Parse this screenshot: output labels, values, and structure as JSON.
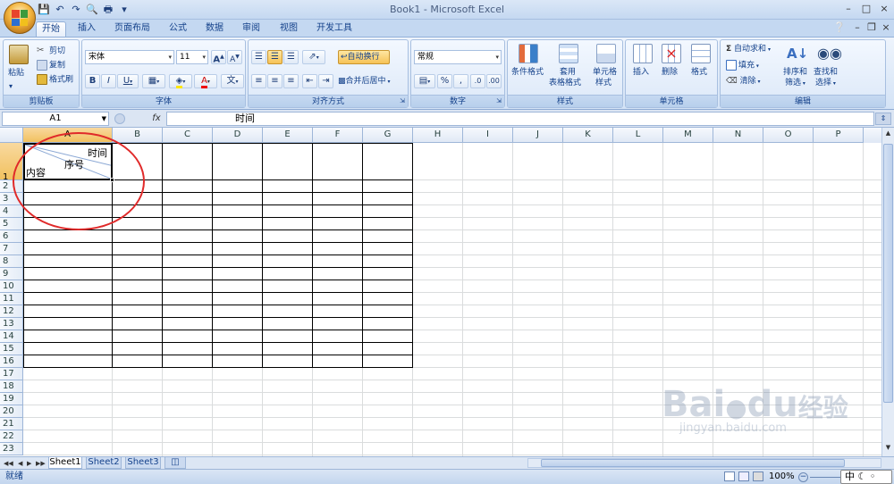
{
  "window": {
    "title": "Book1 - Microsoft Excel",
    "controls": [
      "–",
      "□",
      "×"
    ]
  },
  "tabs": [
    "开始",
    "插入",
    "页面布局",
    "公式",
    "数据",
    "审阅",
    "视图",
    "开发工具"
  ],
  "active_tab": "开始",
  "ribbon": {
    "clipboard": {
      "label": "剪贴板",
      "paste": "粘贴",
      "cut": "剪切",
      "copy": "复制",
      "format_painter": "格式刷"
    },
    "font": {
      "label": "字体",
      "font_name": "宋体",
      "font_size": "11"
    },
    "alignment": {
      "label": "对齐方式",
      "wrap_text": "自动换行",
      "merge_center": "合并后居中"
    },
    "number": {
      "label": "数字",
      "format": "常规"
    },
    "styles": {
      "label": "样式",
      "conditional_format": "条件格式",
      "table_format_l1": "套用",
      "table_format_l2": "表格格式",
      "cell_styles_l1": "单元格",
      "cell_styles_l2": "样式"
    },
    "cells": {
      "label": "单元格",
      "insert": "插入",
      "delete": "删除",
      "format": "格式"
    },
    "editing": {
      "label": "编辑",
      "autosum": "自动求和",
      "fill": "填充",
      "clear": "清除",
      "sort_filter_l1": "排序和",
      "sort_filter_l2": "筛选",
      "find_select_l1": "查找和",
      "find_select_l2": "选择"
    }
  },
  "formula_bar": {
    "name_box": "A1",
    "fx": "fx",
    "value": "时间"
  },
  "columns": [
    "A",
    "B",
    "C",
    "D",
    "E",
    "F",
    "G",
    "H",
    "I",
    "J",
    "K",
    "L",
    "M",
    "N",
    "O",
    "P"
  ],
  "rows": [
    "1",
    "2",
    "3",
    "4",
    "5",
    "6",
    "7",
    "8",
    "9",
    "10",
    "11",
    "12",
    "13",
    "14",
    "15",
    "16",
    "17",
    "18",
    "19",
    "20",
    "21",
    "22",
    "23"
  ],
  "cell_a1": {
    "top_right": "时间",
    "middle": "序号",
    "bottom_left": "内容"
  },
  "sheets": [
    "Sheet1",
    "Sheet2",
    "Sheet3"
  ],
  "active_sheet": "Sheet1",
  "status": {
    "ready": "就绪",
    "zoom": "100%",
    "ime": "中"
  },
  "watermark": {
    "text": "Bai",
    "text2": "du",
    "sub": "jingyan.baidu.com",
    "cn": "经验"
  }
}
